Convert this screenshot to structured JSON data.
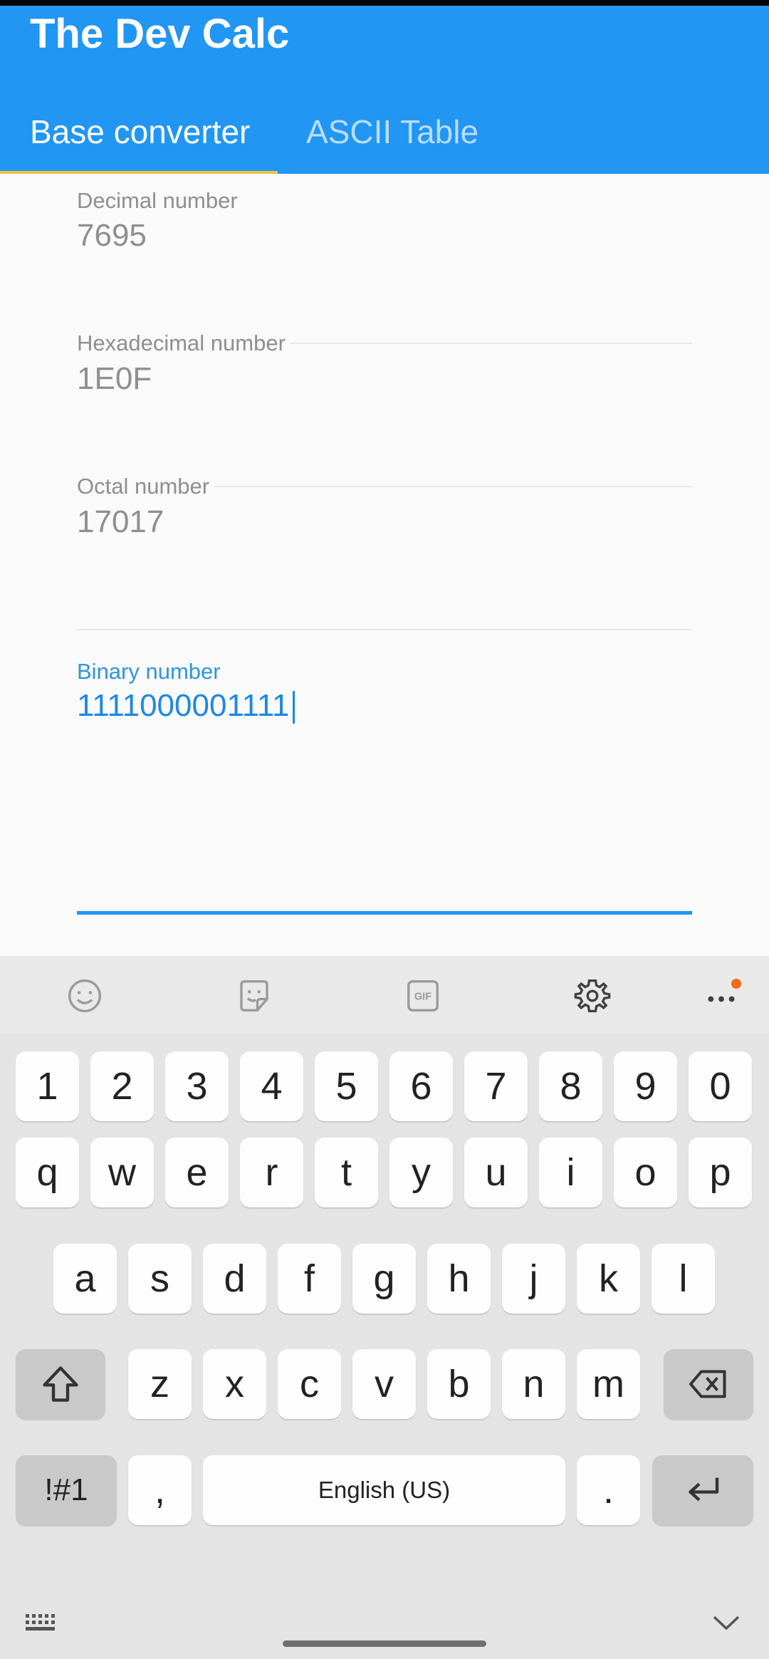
{
  "app": {
    "title": "The Dev Calc"
  },
  "tabs": [
    {
      "label": "Base converter",
      "active": true
    },
    {
      "label": "ASCII Table",
      "active": false
    }
  ],
  "fields": {
    "decimal": {
      "label": "Decimal number",
      "value": "7695"
    },
    "hexadecimal": {
      "label": "Hexadecimal number",
      "value": "1E0F"
    },
    "octal": {
      "label": "Octal number",
      "value": "17017"
    },
    "binary": {
      "label": "Binary number",
      "value": "1111000001111"
    }
  },
  "keyboard": {
    "toolbar_icons": [
      "emoji-icon",
      "sticker-icon",
      "gif-icon",
      "settings-icon",
      "more-icon"
    ],
    "gif_label": "GIF",
    "row_numbers": [
      "1",
      "2",
      "3",
      "4",
      "5",
      "6",
      "7",
      "8",
      "9",
      "0"
    ],
    "row_q": [
      "q",
      "w",
      "e",
      "r",
      "t",
      "y",
      "u",
      "i",
      "o",
      "p"
    ],
    "row_a": [
      "a",
      "s",
      "d",
      "f",
      "g",
      "h",
      "j",
      "k",
      "l"
    ],
    "row_z": [
      "z",
      "x",
      "c",
      "v",
      "b",
      "n",
      "m"
    ],
    "symbols_label": "!#1",
    "comma_label": ",",
    "space_label": "English (US)",
    "period_label": "."
  },
  "colors": {
    "app_bar": "#2196f3",
    "tab_indicator": "#f5c242",
    "accent": "#2196f3",
    "notification_dot": "#f26b1d"
  }
}
